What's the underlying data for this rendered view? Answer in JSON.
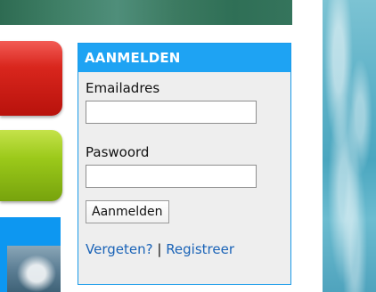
{
  "login": {
    "title": "AANMELDEN",
    "email_label": "Emailadres",
    "email_value": "",
    "password_label": "Paswoord",
    "password_value": "",
    "submit_label": "Aanmelden",
    "forgot_link": "Vergeten?",
    "separator": "|",
    "register_link": "Registreer"
  },
  "colors": {
    "header_blue": "#1ea3f3",
    "link_blue": "#1a63b7",
    "red_button": "#d9261d",
    "green_button": "#9bc91a",
    "panel_bg": "#eeeeee"
  }
}
